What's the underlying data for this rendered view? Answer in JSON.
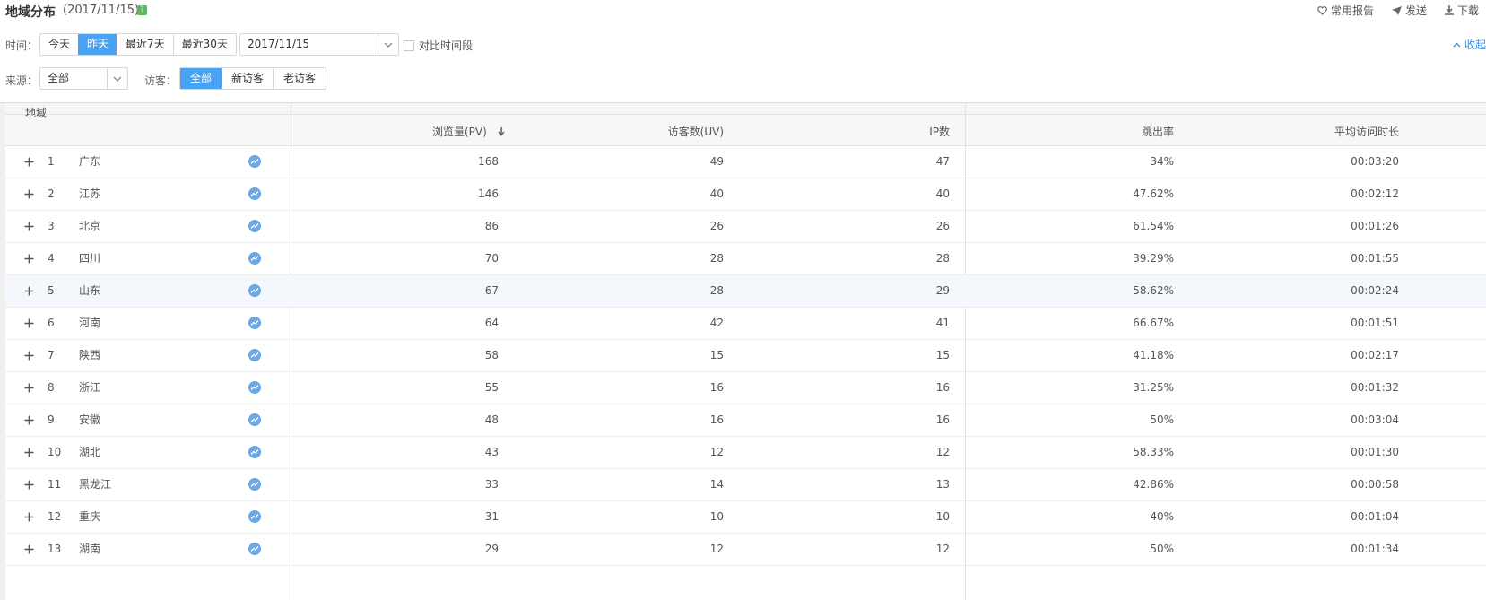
{
  "header": {
    "title": "地域分布",
    "date": "(2017/11/15)",
    "help_icon": "?",
    "actions": [
      {
        "icon": "heart-icon",
        "label": "常用报告"
      },
      {
        "icon": "send-icon",
        "label": "发送"
      },
      {
        "icon": "download-icon",
        "label": "下载"
      }
    ]
  },
  "filters": {
    "time_label": "时间：",
    "time_options": [
      "今天",
      "昨天",
      "最近7天",
      "最近30天"
    ],
    "time_active": 1,
    "date_value": "2017/11/15",
    "compare_label": "对比时间段",
    "collapse_label": "收起",
    "source_label": "来源：",
    "source_value": "全部",
    "visitor_label": "访客：",
    "visitor_options": [
      "全部",
      "新访客",
      "老访客"
    ],
    "visitor_active": 0
  },
  "table": {
    "region_header": "地域",
    "columns": [
      "浏览量(PV)",
      "访客数(UV)",
      "IP数",
      "跳出率",
      "平均访问时长"
    ],
    "rows": [
      {
        "rank": "1",
        "region": "广东",
        "pv": "168",
        "uv": "49",
        "ip": "47",
        "bounce": "34%",
        "duration": "00:03:20"
      },
      {
        "rank": "2",
        "region": "江苏",
        "pv": "146",
        "uv": "40",
        "ip": "40",
        "bounce": "47.62%",
        "duration": "00:02:12"
      },
      {
        "rank": "3",
        "region": "北京",
        "pv": "86",
        "uv": "26",
        "ip": "26",
        "bounce": "61.54%",
        "duration": "00:01:26"
      },
      {
        "rank": "4",
        "region": "四川",
        "pv": "70",
        "uv": "28",
        "ip": "28",
        "bounce": "39.29%",
        "duration": "00:01:55"
      },
      {
        "rank": "5",
        "region": "山东",
        "pv": "67",
        "uv": "28",
        "ip": "29",
        "bounce": "58.62%",
        "duration": "00:02:24"
      },
      {
        "rank": "6",
        "region": "河南",
        "pv": "64",
        "uv": "42",
        "ip": "41",
        "bounce": "66.67%",
        "duration": "00:01:51"
      },
      {
        "rank": "7",
        "region": "陕西",
        "pv": "58",
        "uv": "15",
        "ip": "15",
        "bounce": "41.18%",
        "duration": "00:02:17"
      },
      {
        "rank": "8",
        "region": "浙江",
        "pv": "55",
        "uv": "16",
        "ip": "16",
        "bounce": "31.25%",
        "duration": "00:01:32"
      },
      {
        "rank": "9",
        "region": "安徽",
        "pv": "48",
        "uv": "16",
        "ip": "16",
        "bounce": "50%",
        "duration": "00:03:04"
      },
      {
        "rank": "10",
        "region": "湖北",
        "pv": "43",
        "uv": "12",
        "ip": "12",
        "bounce": "58.33%",
        "duration": "00:01:30"
      },
      {
        "rank": "11",
        "region": "黑龙江",
        "pv": "33",
        "uv": "14",
        "ip": "13",
        "bounce": "42.86%",
        "duration": "00:00:58"
      },
      {
        "rank": "12",
        "region": "重庆",
        "pv": "31",
        "uv": "10",
        "ip": "10",
        "bounce": "40%",
        "duration": "00:01:04"
      },
      {
        "rank": "13",
        "region": "湖南",
        "pv": "29",
        "uv": "12",
        "ip": "12",
        "bounce": "50%",
        "duration": "00:01:34"
      }
    ]
  },
  "colors": {
    "accent": "#4aa3f2",
    "help": "#5bb75b",
    "link": "#3a8ee6"
  }
}
